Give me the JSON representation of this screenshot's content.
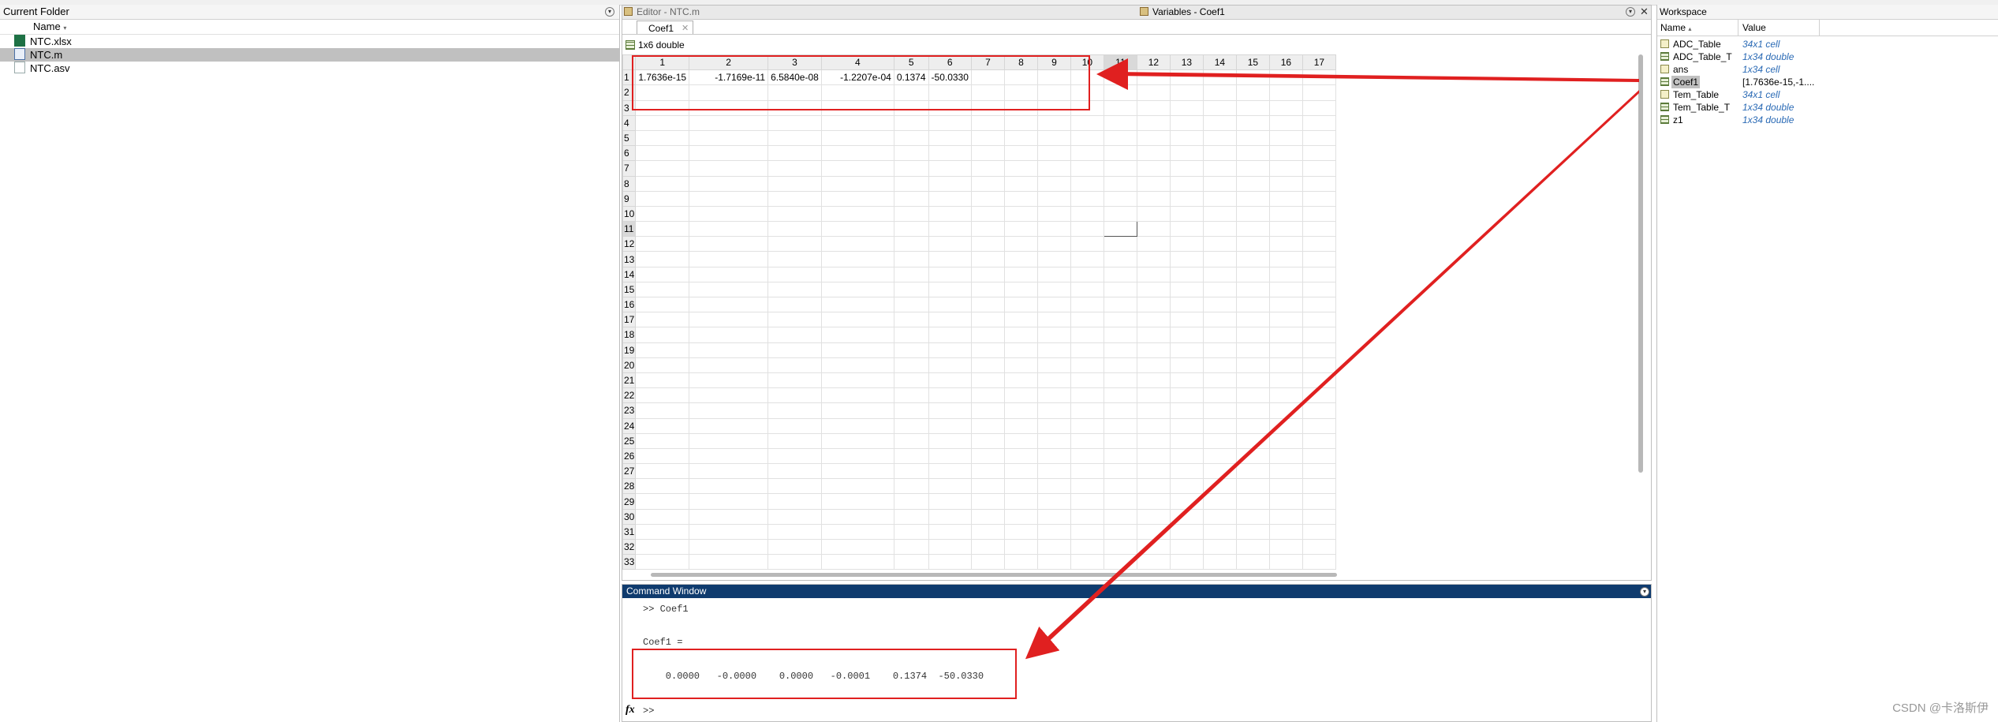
{
  "folder": {
    "title": "Current Folder",
    "col_name": "Name",
    "files": [
      {
        "name": "NTC.xlsx",
        "type": "xlsx"
      },
      {
        "name": "NTC.m",
        "type": "m",
        "selected": true
      },
      {
        "name": "NTC.asv",
        "type": "asv"
      }
    ]
  },
  "editor_tab": "Editor - NTC.m",
  "variables_title": "Variables - Coef1",
  "var_tab": "Coef1",
  "var_size": "1x6 double",
  "columns": [
    "1",
    "2",
    "3",
    "4",
    "5",
    "6",
    "7",
    "8",
    "9",
    "10",
    "11",
    "12",
    "13",
    "14",
    "15",
    "16",
    "17"
  ],
  "row1_values": [
    "1.7636e-15",
    "-1.7169e-11",
    "6.5840e-08",
    "-1.2207e-04",
    "0.1374",
    "-50.0330"
  ],
  "rows": [
    "1",
    "2",
    "3",
    "4",
    "5",
    "6",
    "7",
    "8",
    "9",
    "10",
    "11",
    "12",
    "13",
    "14",
    "15",
    "16",
    "17",
    "18",
    "19",
    "20",
    "21",
    "22",
    "23",
    "24",
    "25",
    "26",
    "27",
    "28",
    "29",
    "30",
    "31",
    "32",
    "33"
  ],
  "command": {
    "title": "Command Window",
    "prompt1": ">> Coef1",
    "assign": "Coef1 =",
    "values_line": "    0.0000   -0.0000    0.0000   -0.0001    0.1374  -50.0330",
    "prompt2": ">>",
    "fx": "fx"
  },
  "workspace": {
    "title": "Workspace",
    "col_name": "Name",
    "col_value": "Value",
    "vars": [
      {
        "name": "ADC_Table",
        "value": "34x1 cell",
        "icon": "cell"
      },
      {
        "name": "ADC_Table_T",
        "value": "1x34 double",
        "icon": "grid"
      },
      {
        "name": "ans",
        "value": "1x34 cell",
        "icon": "cell"
      },
      {
        "name": "Coef1",
        "value": "[1.7636e-15,-1....",
        "icon": "grid",
        "selected": true
      },
      {
        "name": "Tem_Table",
        "value": "34x1 cell",
        "icon": "cell"
      },
      {
        "name": "Tem_Table_T",
        "value": "1x34 double",
        "icon": "grid"
      },
      {
        "name": "z1",
        "value": "1x34 double",
        "icon": "grid"
      }
    ]
  },
  "watermark": "CSDN @卡洛斯伊",
  "colors": {
    "annotation_red": "#e02020",
    "command_title_bg": "#0f3b6e",
    "selection_gray": "#c0c0c0"
  }
}
